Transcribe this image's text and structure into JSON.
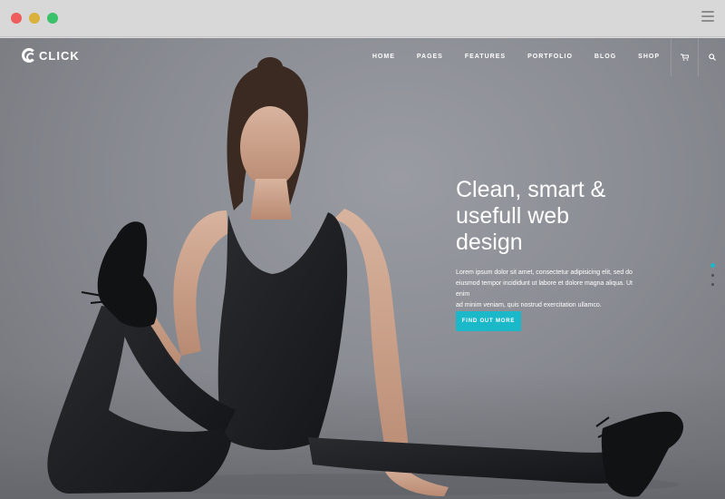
{
  "window": {
    "controls": [
      "close",
      "minimize",
      "maximize"
    ],
    "colors": {
      "close": "#ee5d5b",
      "minimize": "#d9b13c",
      "maximize": "#3cc16b"
    },
    "menu_icon": "hamburger-icon"
  },
  "brand": {
    "name": "CLICK",
    "logo_icon": "c-ring-logo"
  },
  "nav": {
    "items": [
      "HOME",
      "PAGES",
      "FEATURES",
      "PORTFOLIO",
      "BLOG",
      "SHOP"
    ],
    "icons": [
      "cart-icon",
      "search-icon"
    ]
  },
  "hero": {
    "headline_lines": [
      "Clean, smart &",
      "usefull web",
      "design"
    ],
    "body_lines": [
      "Lorem ipsum dolor sit amet, consectetur adipisicing elit, sed do",
      "eiusmod tempor incididunt ut labore et dolore magna aliqua. Ut enim",
      "ad minim veniam, quis nostrud exercitation ullamco."
    ],
    "cta_label": "FIND OUT MORE",
    "accent_color": "#1bb8c9"
  },
  "slider": {
    "count": 3,
    "active_index": 0,
    "active_color": "#1bb8c9"
  }
}
